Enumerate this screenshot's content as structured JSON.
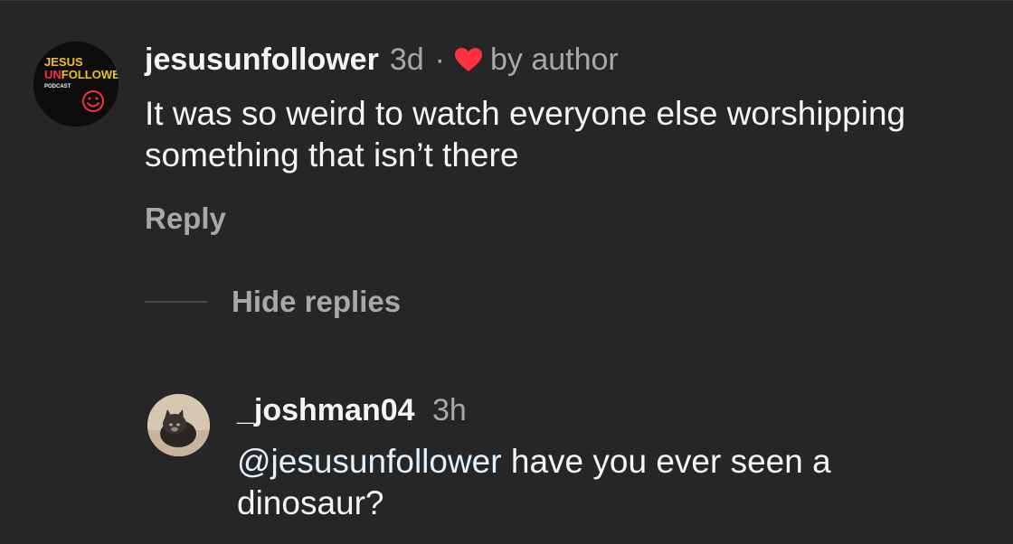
{
  "comment": {
    "username": "jesusunfollower",
    "time": "3d",
    "separator": "·",
    "liked_by": "by author",
    "text": "It was so weird to watch everyone else worshipping something that isn’t there",
    "reply_label": "Reply",
    "hide_replies_label": "Hide replies",
    "avatar": {
      "line1": "JESUS",
      "line2_accent": "UN",
      "line2_rest": "FOLLOWER",
      "line3": "PODCAST"
    }
  },
  "reply": {
    "username": "_joshman04",
    "time": "3h",
    "mention": "@jesusunfollower",
    "text": " have you ever seen a dinosaur?"
  },
  "colors": {
    "background": "#262626",
    "text": "#f5f5f5",
    "muted": "#a8a8a8",
    "heart": "#ff3040",
    "mention": "#e0f1ff",
    "avatar_yellow": "#f2c21b",
    "avatar_red": "#ff2d3d"
  },
  "icons": {
    "heart": "heart-icon"
  }
}
